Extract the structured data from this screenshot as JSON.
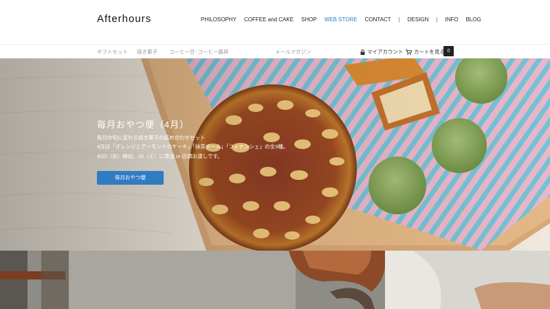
{
  "header": {
    "logo": "Afterhours",
    "nav": [
      "PHILOSOPHY",
      "COFFEE and CAKE",
      "SHOP",
      "WEB STORE",
      "CONTACT"
    ],
    "nav_active": "WEB STORE",
    "nav_secondary": [
      "DESIGN",
      "INFO",
      "BLOG"
    ],
    "separator": "|"
  },
  "subnav": {
    "items": [
      "ギフトセット",
      "焼き菓子",
      "コーヒー豆･コーヒー器具",
      "メールマガジン"
    ],
    "account": "マイアカウント",
    "cart": "カートを見る",
    "cart_count": "0"
  },
  "hero": {
    "title": "毎月おやつ便（4月）",
    "lines": [
      "毎月中旬に変わる焼き菓子の詰め合わせセット",
      "4月は「オレンジとアーモンドのケーキ」「抹茶ボール」「フィナンシェ」の全3種。",
      "4/22（水）締切、25（土）に発送 or 店頭お渡しです。"
    ],
    "button": "毎月おやつ便"
  },
  "colors": {
    "accent": "#2f7cc2",
    "text": "#222222",
    "muted": "#9a9a9a"
  }
}
